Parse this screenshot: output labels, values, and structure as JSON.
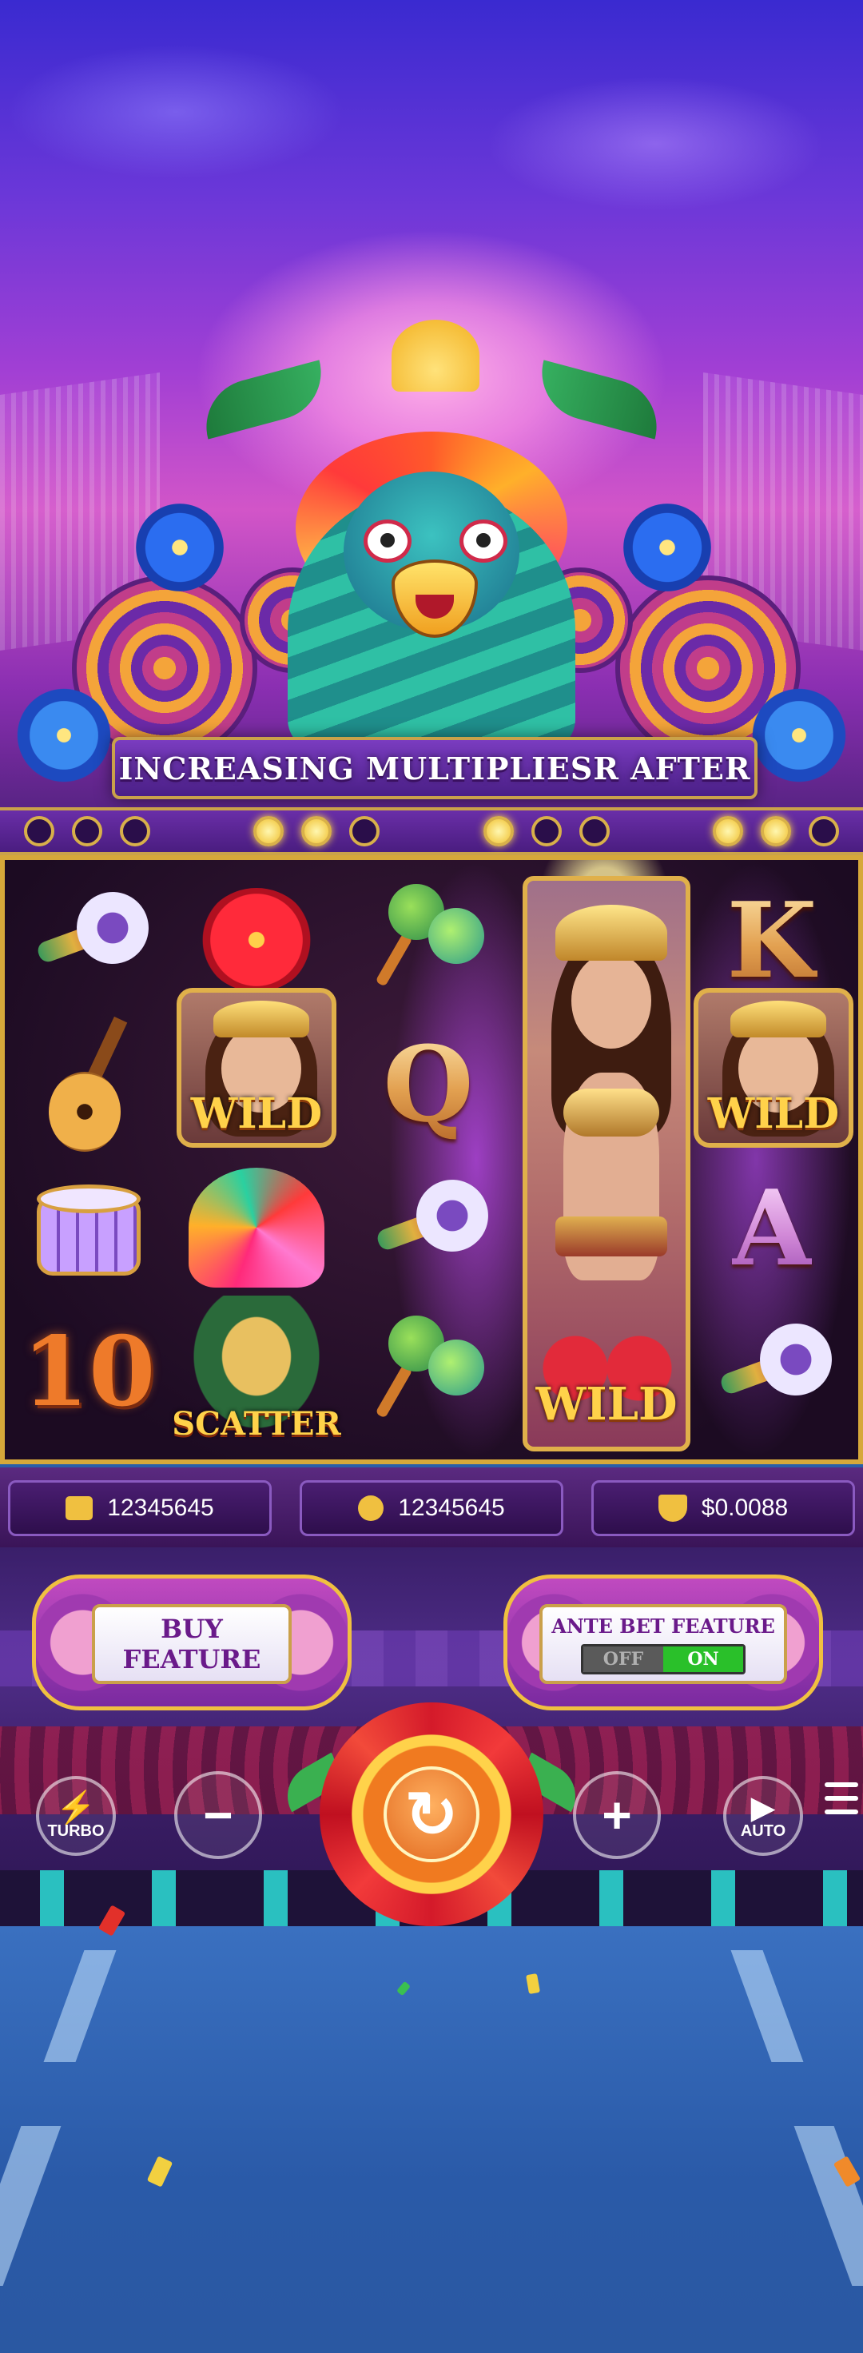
{
  "banner": {
    "text": "INCREASING MULTIPLIESR AFTER"
  },
  "reels": {
    "symbols": {
      "k": "K",
      "q": "Q",
      "a": "A",
      "ten": "10",
      "wild": "WILD",
      "scatter": "SCATTER"
    }
  },
  "stats": {
    "balance": {
      "icon": "wallet-icon",
      "value": "12345645"
    },
    "bet": {
      "icon": "coins-icon",
      "value": "12345645"
    },
    "win": {
      "icon": "trophy-icon",
      "value": "$0.0088"
    }
  },
  "features": {
    "buy": {
      "line1": "BUY",
      "line2": "FEATURE"
    },
    "ante": {
      "title": "ANTE BET FEATURE",
      "off_label": "OFF",
      "on_label": "ON",
      "state": "ON"
    }
  },
  "controls": {
    "turbo_label": "TURBO",
    "auto_label": "AUTO",
    "minus_glyph": "−",
    "plus_glyph": "+",
    "spin_glyph": "↻"
  },
  "colors": {
    "gold_border": "#d6a83a",
    "panel_purple": "#4a1e72",
    "toggle_on": "#2ac02a"
  }
}
